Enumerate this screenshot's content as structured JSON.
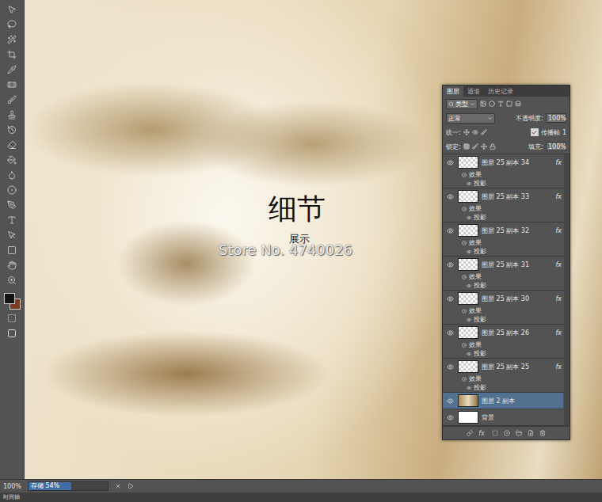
{
  "canvas": {
    "watermark": {
      "title": "细节",
      "subtitle": "展示",
      "store": "Store No. 4740026"
    }
  },
  "tool_colors": {
    "foreground": "#141414",
    "background": "#7a3d22"
  },
  "layers_panel": {
    "tabs": [
      {
        "label": "图层",
        "selected": true
      },
      {
        "label": "通道",
        "selected": false
      },
      {
        "label": "历史记录",
        "selected": false
      }
    ],
    "filter": "类型",
    "blend_mode": "正常",
    "opacity_label": "不透明度:",
    "opacity": "100%",
    "unify_label": "统一:",
    "propagate": {
      "label": "传播帧",
      "checked": true,
      "value": "1"
    },
    "lock_label": "锁定:",
    "fill_label": "填充:",
    "fill": "100%",
    "footer_fx": "fx",
    "layers": [
      {
        "name": "图层 25 副本 34",
        "kind": "effects",
        "fx": "fx",
        "effects_label": "效果",
        "effects": [
          "投影"
        ],
        "visible": true,
        "selected": false
      },
      {
        "name": "图层 25 副本 33",
        "kind": "effects",
        "fx": "fx",
        "effects_label": "效果",
        "effects": [
          "投影"
        ],
        "visible": true,
        "selected": false
      },
      {
        "name": "图层 25 副本 32",
        "kind": "effects",
        "fx": "fx",
        "effects_label": "效果",
        "effects": [
          "投影"
        ],
        "visible": true,
        "selected": false
      },
      {
        "name": "图层 25 副本 31",
        "kind": "effects",
        "fx": "fx",
        "effects_label": "效果",
        "effects": [
          "投影"
        ],
        "visible": true,
        "selected": false
      },
      {
        "name": "图层 25 副本 30",
        "kind": "effects",
        "fx": "fx",
        "effects_label": "效果",
        "effects": [
          "投影"
        ],
        "visible": true,
        "selected": false
      },
      {
        "name": "图层 25 副本 26",
        "kind": "effects",
        "fx": "fx",
        "effects_label": "效果",
        "effects": [
          "投影"
        ],
        "visible": true,
        "selected": false
      },
      {
        "name": "图层 25 副本 25",
        "kind": "effects",
        "fx": "fx",
        "effects_label": "效果",
        "effects": [
          "投影"
        ],
        "visible": true,
        "selected": false
      },
      {
        "name": "图层 2 副本",
        "kind": "image",
        "fx": "",
        "effects_label": "",
        "effects": [],
        "visible": true,
        "selected": true
      },
      {
        "name": "背景",
        "kind": "background",
        "fx": "",
        "effects_label": "",
        "effects": [],
        "visible": true,
        "selected": false
      }
    ]
  },
  "status_bar": {
    "zoom": "100%",
    "save": {
      "label": "存储 54%",
      "level": 0.54
    }
  },
  "timeline": {
    "label": "时间轴"
  }
}
